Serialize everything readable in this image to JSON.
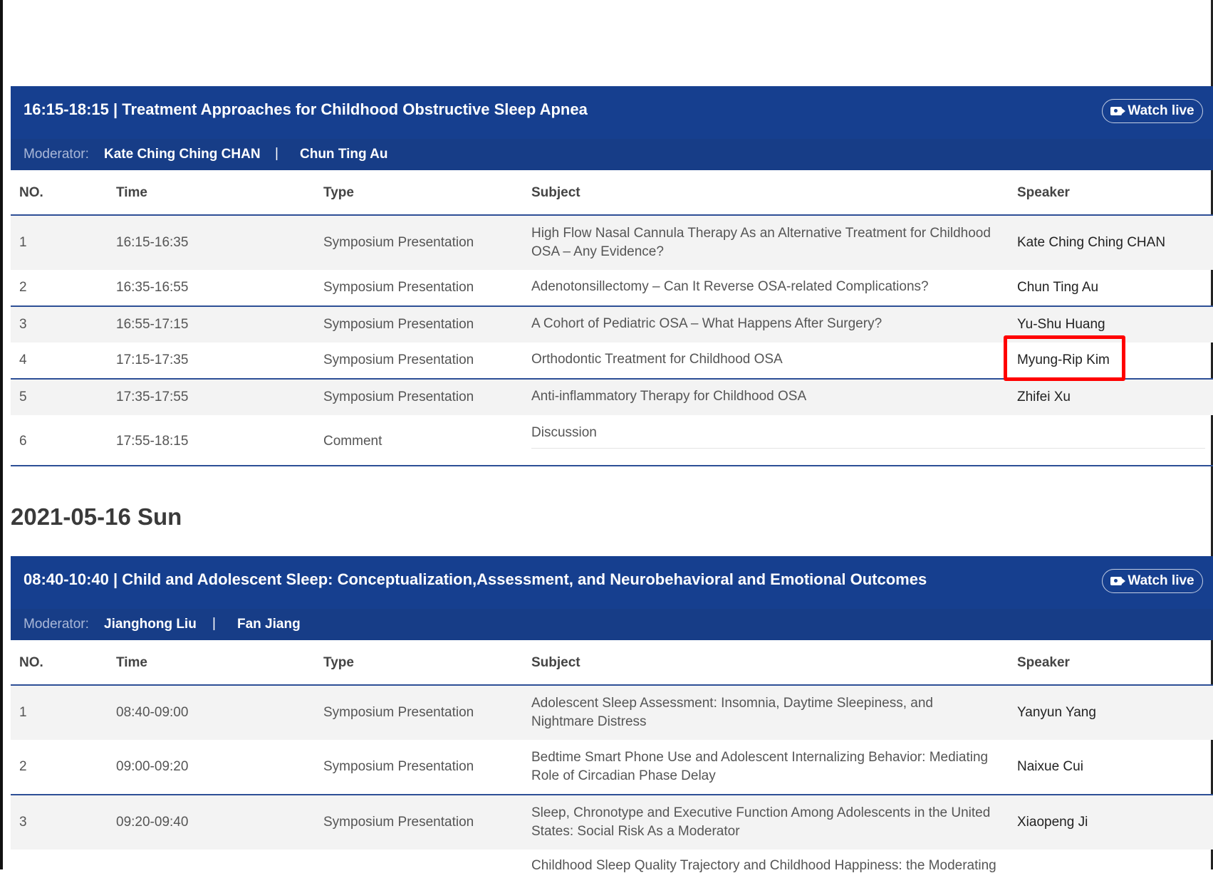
{
  "session1": {
    "title": "16:15-18:15 | Treatment Approaches for Childhood Obstructive Sleep Apnea",
    "watch_label": "Watch live",
    "moderator_label": "Moderator:",
    "moderators": [
      "Kate Ching Ching CHAN",
      "Chun Ting Au"
    ],
    "separator": "|",
    "columns": [
      "NO.",
      "Time",
      "Type",
      "Subject",
      "Speaker"
    ],
    "rows": [
      {
        "no": "1",
        "time": "16:15-16:35",
        "type": "Symposium Presentation",
        "subject": "High Flow Nasal Cannula Therapy As an Alternative Treatment for Childhood OSA – Any Evidence?",
        "speaker": "Kate Ching Ching CHAN"
      },
      {
        "no": "2",
        "time": "16:35-16:55",
        "type": "Symposium Presentation",
        "subject": "Adenotonsillectomy – Can It Reverse OSA-related Complications?",
        "speaker": "Chun Ting Au"
      },
      {
        "no": "3",
        "time": "16:55-17:15",
        "type": "Symposium Presentation",
        "subject": "A Cohort of Pediatric OSA – What Happens After Surgery?",
        "speaker": "Yu-Shu Huang"
      },
      {
        "no": "4",
        "time": "17:15-17:35",
        "type": "Symposium Presentation",
        "subject": "Orthodontic Treatment for Childhood OSA",
        "speaker": "Myung-Rip Kim"
      },
      {
        "no": "5",
        "time": "17:35-17:55",
        "type": "Symposium Presentation",
        "subject": "Anti-inflammatory Therapy for Childhood OSA",
        "speaker": "Zhifei Xu"
      },
      {
        "no": "6",
        "time": "17:55-18:15",
        "type": "Comment",
        "subject": "Discussion",
        "speaker": ""
      }
    ]
  },
  "date_heading": "2021-05-16 Sun",
  "session2": {
    "title": "08:40-10:40 | Child and Adolescent Sleep: Conceptualization,Assessment, and Neurobehavioral and Emotional Outcomes",
    "watch_label": "Watch live",
    "moderator_label": "Moderator:",
    "moderators": [
      "Jianghong Liu",
      "Fan Jiang"
    ],
    "separator": "|",
    "columns": [
      "NO.",
      "Time",
      "Type",
      "Subject",
      "Speaker"
    ],
    "rows": [
      {
        "no": "1",
        "time": "08:40-09:00",
        "type": "Symposium Presentation",
        "subject": "Adolescent Sleep Assessment: Insomnia, Daytime Sleepiness, and Nightmare Distress",
        "speaker": "Yanyun Yang"
      },
      {
        "no": "2",
        "time": "09:00-09:20",
        "type": "Symposium Presentation",
        "subject": "Bedtime Smart Phone Use and Adolescent Internalizing Behavior: Mediating Role of Circadian Phase Delay",
        "speaker": "Naixue Cui"
      },
      {
        "no": "3",
        "time": "09:20-09:40",
        "type": "Symposium Presentation",
        "subject": "Sleep, Chronotype and Executive Function Among Adolescents in the United States: Social Risk As a Moderator",
        "speaker": "Xiaopeng Ji"
      },
      {
        "no": "",
        "time": "",
        "type": "",
        "subject": "Childhood Sleep Quality Trajectory and Childhood Happiness: the Moderating",
        "speaker": ""
      }
    ]
  }
}
